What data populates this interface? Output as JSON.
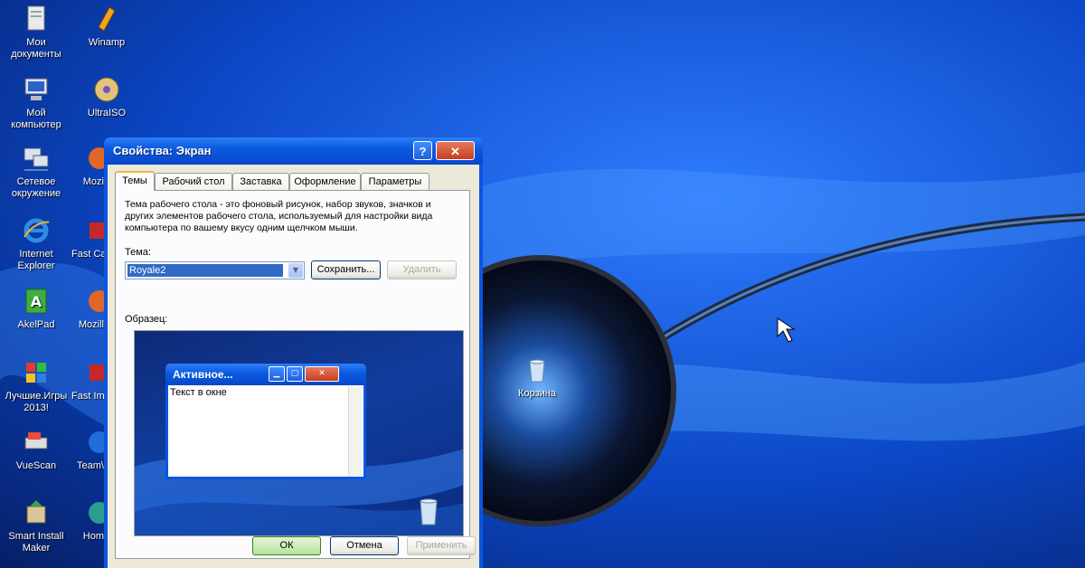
{
  "desktop": {
    "icons_left": [
      {
        "label": "Мои документы",
        "icon": "documents-icon"
      },
      {
        "label": "Мой компьютер",
        "icon": "computer-icon"
      },
      {
        "label": "Сетевое окружение",
        "icon": "network-icon"
      },
      {
        "label": "Internet Explorer",
        "icon": "ie-icon"
      },
      {
        "label": "AkelPad",
        "icon": "akelpad-icon"
      },
      {
        "label": "Лучшие.Игры 2013!",
        "icon": "games-icon"
      },
      {
        "label": "VueScan",
        "icon": "vuescan-icon"
      },
      {
        "label": "Smart Install Maker",
        "icon": "installer-icon"
      }
    ],
    "icons_right": [
      {
        "label": "Winamp",
        "icon": "winamp-icon"
      },
      {
        "label": "UltraISO",
        "icon": "ultraiso-icon"
      },
      {
        "label": "Mozi",
        "icon": "mozilla-icon"
      },
      {
        "label": "Fast Cap",
        "icon": "fastcap-icon"
      },
      {
        "label": "Mozill",
        "icon": "mozilla-icon"
      },
      {
        "label": "Fast Imag",
        "icon": "fastimage-icon"
      },
      {
        "label": "Team\\",
        "icon": "teamviewer-icon"
      },
      {
        "label": "Hom",
        "icon": "home-icon"
      }
    ],
    "recycle_bin_label": "Корзина"
  },
  "dialog": {
    "title": "Свойства: Экран",
    "help_symbol": "?",
    "close_symbol": "✕",
    "tabs": [
      "Темы",
      "Рабочий стол",
      "Заставка",
      "Оформление",
      "Параметры"
    ],
    "active_tab": "Темы",
    "description": "Тема рабочего стола - это фоновый рисунок, набор звуков, значков и других элементов рабочего стола, используемый для настройки вида компьютера по вашему вкусу одним щелчком мыши.",
    "theme_label": "Тема:",
    "theme_value": "Royale2",
    "save_label": "Сохранить...",
    "delete_label": "Удалить",
    "sample_label": "Образец:",
    "preview": {
      "window_title": "Активное...",
      "window_text": "Текст в окне"
    },
    "ok_label": "ОК",
    "cancel_label": "Отмена",
    "apply_label": "Применить"
  }
}
